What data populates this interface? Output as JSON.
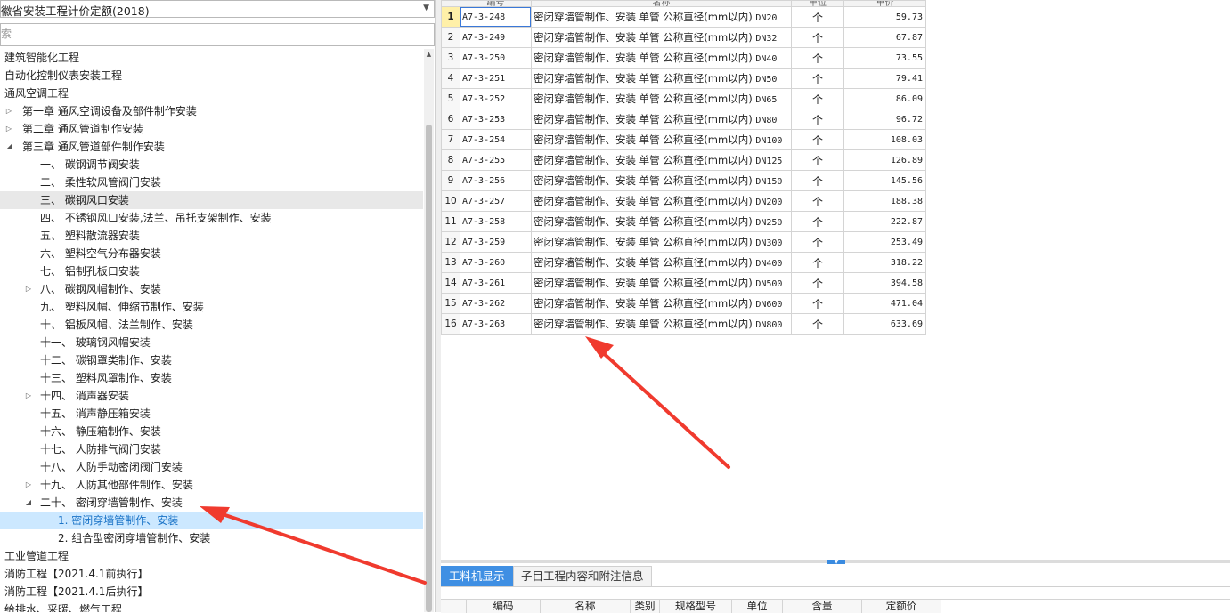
{
  "left_panel": {
    "library_select": "徽省安装工程计价定额(2018)",
    "search_placeholder": "索",
    "tree": [
      {
        "label": "建筑智能化工程",
        "level": 0,
        "toggle": ""
      },
      {
        "label": "自动化控制仪表安装工程",
        "level": 0,
        "toggle": ""
      },
      {
        "label": "通风空调工程",
        "level": 0,
        "toggle": ""
      },
      {
        "label": "第一章 通风空调设备及部件制作安装",
        "level": 1,
        "toggle": "▷"
      },
      {
        "label": "第二章 通风管道制作安装",
        "level": 1,
        "toggle": "▷"
      },
      {
        "label": "第三章 通风管道部件制作安装",
        "level": 1,
        "toggle": "◢"
      },
      {
        "label": "一、 碳钢调节阀安装",
        "level": 2,
        "toggle": ""
      },
      {
        "label": "二、 柔性软风管阀门安装",
        "level": 2,
        "toggle": ""
      },
      {
        "label": "三、 碳钢风口安装",
        "level": 2,
        "toggle": "",
        "state": "hover"
      },
      {
        "label": "四、 不锈钢风口安装,法兰、吊托支架制作、安装",
        "level": 2,
        "toggle": ""
      },
      {
        "label": "五、 塑料散流器安装",
        "level": 2,
        "toggle": ""
      },
      {
        "label": "六、 塑料空气分布器安装",
        "level": 2,
        "toggle": ""
      },
      {
        "label": "七、 铝制孔板口安装",
        "level": 2,
        "toggle": ""
      },
      {
        "label": "八、 碳钢风帽制作、安装",
        "level": 2,
        "toggle": "▷"
      },
      {
        "label": "九、 塑料风帽、伸缩节制作、安装",
        "level": 2,
        "toggle": ""
      },
      {
        "label": "十、 铝板风帽、法兰制作、安装",
        "level": 2,
        "toggle": ""
      },
      {
        "label": "十一、 玻璃钢风帽安装",
        "level": 2,
        "toggle": ""
      },
      {
        "label": "十二、 碳钢罩类制作、安装",
        "level": 2,
        "toggle": ""
      },
      {
        "label": "十三、 塑料风罩制作、安装",
        "level": 2,
        "toggle": ""
      },
      {
        "label": "十四、 消声器安装",
        "level": 2,
        "toggle": "▷"
      },
      {
        "label": "十五、 消声静压箱安装",
        "level": 2,
        "toggle": ""
      },
      {
        "label": "十六、 静压箱制作、安装",
        "level": 2,
        "toggle": ""
      },
      {
        "label": "十七、 人防排气阀门安装",
        "level": 2,
        "toggle": ""
      },
      {
        "label": "十八、 人防手动密闭阀门安装",
        "level": 2,
        "toggle": ""
      },
      {
        "label": "十九、 人防其他部件制作、安装",
        "level": 2,
        "toggle": "▷"
      },
      {
        "label": "二十、 密闭穿墙管制作、安装",
        "level": 2,
        "toggle": "◢"
      },
      {
        "label": "1. 密闭穿墙管制作、安装",
        "level": 3,
        "toggle": "",
        "state": "selected"
      },
      {
        "label": "2. 组合型密闭穿墙管制作、安装",
        "level": 3,
        "toggle": ""
      },
      {
        "label": "工业管道工程",
        "level": 0,
        "toggle": ""
      },
      {
        "label": "消防工程【2021.4.1前执行】",
        "level": 0,
        "toggle": ""
      },
      {
        "label": "消防工程【2021.4.1后执行】",
        "level": 0,
        "toggle": ""
      },
      {
        "label": "给排水、采暖、燃气工程",
        "level": 0,
        "toggle": ""
      }
    ]
  },
  "main_grid": {
    "columns": [
      "编号",
      "名称",
      "单位",
      "单价"
    ],
    "rows": [
      {
        "no": "1",
        "code": "A7-3-248",
        "name": "密闭穿墙管制作、安装 单管 公称直径(mm以内)",
        "dn": "DN20",
        "unit": "个",
        "price": "59.73"
      },
      {
        "no": "2",
        "code": "A7-3-249",
        "name": "密闭穿墙管制作、安装 单管 公称直径(mm以内)",
        "dn": "DN32",
        "unit": "个",
        "price": "67.87"
      },
      {
        "no": "3",
        "code": "A7-3-250",
        "name": "密闭穿墙管制作、安装 单管 公称直径(mm以内)",
        "dn": "DN40",
        "unit": "个",
        "price": "73.55"
      },
      {
        "no": "4",
        "code": "A7-3-251",
        "name": "密闭穿墙管制作、安装 单管 公称直径(mm以内)",
        "dn": "DN50",
        "unit": "个",
        "price": "79.41"
      },
      {
        "no": "5",
        "code": "A7-3-252",
        "name": "密闭穿墙管制作、安装 单管 公称直径(mm以内)",
        "dn": "DN65",
        "unit": "个",
        "price": "86.09"
      },
      {
        "no": "6",
        "code": "A7-3-253",
        "name": "密闭穿墙管制作、安装 单管 公称直径(mm以内)",
        "dn": "DN80",
        "unit": "个",
        "price": "96.72"
      },
      {
        "no": "7",
        "code": "A7-3-254",
        "name": "密闭穿墙管制作、安装 单管 公称直径(mm以内)",
        "dn": "DN100",
        "unit": "个",
        "price": "108.03"
      },
      {
        "no": "8",
        "code": "A7-3-255",
        "name": "密闭穿墙管制作、安装 单管 公称直径(mm以内)",
        "dn": "DN125",
        "unit": "个",
        "price": "126.89"
      },
      {
        "no": "9",
        "code": "A7-3-256",
        "name": "密闭穿墙管制作、安装 单管 公称直径(mm以内)",
        "dn": "DN150",
        "unit": "个",
        "price": "145.56"
      },
      {
        "no": "10",
        "code": "A7-3-257",
        "name": "密闭穿墙管制作、安装 单管 公称直径(mm以内)",
        "dn": "DN200",
        "unit": "个",
        "price": "188.38"
      },
      {
        "no": "11",
        "code": "A7-3-258",
        "name": "密闭穿墙管制作、安装 单管 公称直径(mm以内)",
        "dn": "DN250",
        "unit": "个",
        "price": "222.87"
      },
      {
        "no": "12",
        "code": "A7-3-259",
        "name": "密闭穿墙管制作、安装 单管 公称直径(mm以内)",
        "dn": "DN300",
        "unit": "个",
        "price": "253.49"
      },
      {
        "no": "13",
        "code": "A7-3-260",
        "name": "密闭穿墙管制作、安装 单管 公称直径(mm以内)",
        "dn": "DN400",
        "unit": "个",
        "price": "318.22"
      },
      {
        "no": "14",
        "code": "A7-3-261",
        "name": "密闭穿墙管制作、安装 单管 公称直径(mm以内)",
        "dn": "DN500",
        "unit": "个",
        "price": "394.58"
      },
      {
        "no": "15",
        "code": "A7-3-262",
        "name": "密闭穿墙管制作、安装 单管 公称直径(mm以内)",
        "dn": "DN600",
        "unit": "个",
        "price": "471.04"
      },
      {
        "no": "16",
        "code": "A7-3-263",
        "name": "密闭穿墙管制作、安装 单管 公称直径(mm以内)",
        "dn": "DN800",
        "unit": "个",
        "price": "633.69"
      }
    ]
  },
  "bottom_panel": {
    "tabs": [
      {
        "label": "工料机显示",
        "active": true
      },
      {
        "label": "子目工程内容和附注信息",
        "active": false
      }
    ],
    "columns": [
      "编码",
      "名称",
      "类别",
      "规格型号",
      "单位",
      "含量",
      "定额价"
    ]
  },
  "colors": {
    "selected_bg": "#cce8ff",
    "selected_text": "#1a73c7",
    "active_tab": "#3f8fe3",
    "annotation_arrow": "#f03a2e"
  }
}
